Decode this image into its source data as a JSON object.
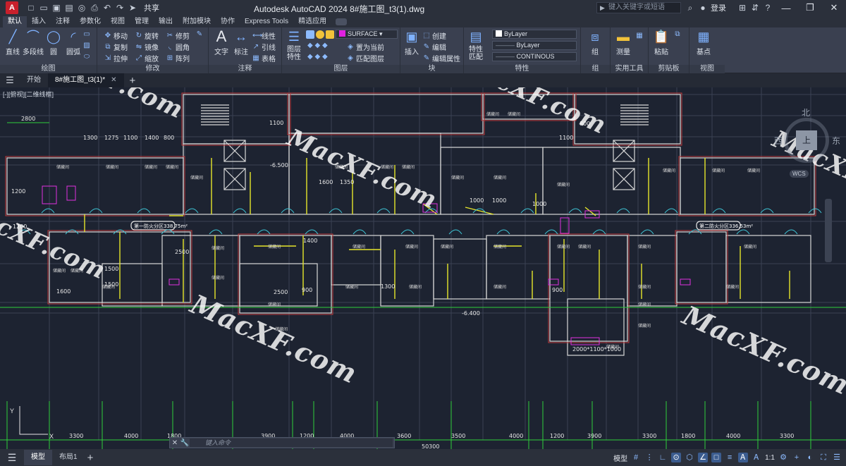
{
  "titlebar": {
    "logo": "A",
    "share": "共享",
    "title": "Autodesk AutoCAD 2024    8#施工图_t3(1).dwg",
    "search_placeholder": "键入关键字或短语",
    "login": "登录",
    "help": "?"
  },
  "ribbon_tabs": [
    "默认",
    "插入",
    "注释",
    "参数化",
    "视图",
    "管理",
    "输出",
    "附加模块",
    "协作",
    "Express Tools",
    "精选应用"
  ],
  "ribbon": {
    "draw": {
      "title": "绘图",
      "line": "直线",
      "polyline": "多段线",
      "circle": "圆",
      "arc": "圆弧"
    },
    "modify": {
      "title": "修改",
      "move": "移动",
      "rotate": "旋转",
      "trim": "修剪",
      "copy": "复制",
      "mirror": "镜像",
      "fillet": "圆角",
      "stretch": "拉伸",
      "scale": "缩放",
      "array": "阵列"
    },
    "annotation": {
      "title": "注释",
      "text": "文字",
      "dimension": "标注",
      "linear": "线性",
      "leader": "引线",
      "table": "表格"
    },
    "layers": {
      "title": "图层",
      "props": "图层\n特性",
      "current_layer": "SURFACE",
      "make_current": "置为当前",
      "match": "匹配图层"
    },
    "block": {
      "title": "块",
      "insert": "插入",
      "create": "创建",
      "edit": "编辑",
      "edit_attr": "编辑属性"
    },
    "properties": {
      "title": "特性",
      "match": "特性\n匹配",
      "color": "ByLayer",
      "lineweight": "ByLayer",
      "linetype": "CONTINOUS"
    },
    "groups": {
      "title": "组",
      "group": "组"
    },
    "utilities": {
      "title": "实用工具",
      "measure": "测量"
    },
    "clipboard": {
      "title": "剪贴板",
      "paste": "粘贴"
    },
    "view": {
      "title": "视图",
      "base": "基点"
    }
  },
  "doc_tabs": {
    "start": "开始",
    "active": "8#施工图_t3(1)*"
  },
  "viewport_label": "[-][俯视][二维线框]",
  "viewcube": {
    "north": "北",
    "west": "西",
    "east": "东",
    "face": "上",
    "wcs": "WCS"
  },
  "watermark": "MacXF.com",
  "drawing": {
    "top_dims": [
      "2800",
      "1100",
      "1300",
      "1275",
      "1100",
      "1400",
      "800",
      "1100",
      "800"
    ],
    "bottom_dims": [
      "3300",
      "4000",
      "1800",
      "3900",
      "1200",
      "4000",
      "3600",
      "3500",
      "4000",
      "1200",
      "3900",
      "3300",
      "1800",
      "4000",
      "3300"
    ],
    "total_dim": "50300",
    "zone_labels": [
      "第一防火分区338.75m²",
      "第二防火分区336.53m²"
    ],
    "level_marks": [
      "-6.500",
      "-6.400"
    ],
    "room_label": "储藏间",
    "misc_dims": [
      "1200",
      "1200",
      "1600",
      "1350",
      "1000",
      "1000",
      "1000",
      "1500",
      "1500",
      "2500",
      "2500",
      "1400",
      "1300",
      "900",
      "900",
      "1600",
      "2000*1100*1000"
    ]
  },
  "command_line": {
    "placeholder": "键入命令"
  },
  "statusbar": {
    "tabs": [
      "模型",
      "布局1"
    ],
    "mode": "模型",
    "scale": "1:1"
  }
}
